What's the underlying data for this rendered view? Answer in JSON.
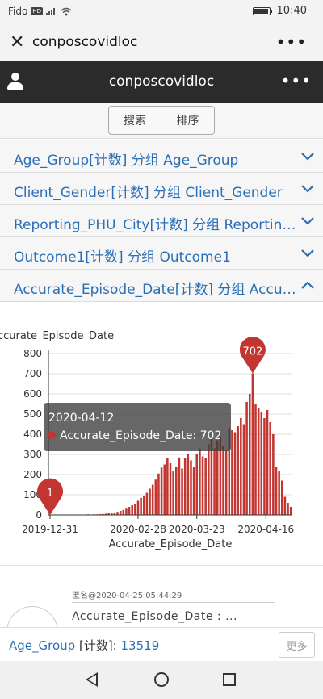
{
  "status_bar": {
    "carrier": "Fido",
    "carrier_badge": "HD",
    "time": "10:40"
  },
  "browser": {
    "title": "conposcovidloc",
    "close_icon": "close-icon",
    "more_icon": "more-icon"
  },
  "app_header": {
    "title": "conposcovidloc",
    "user_icon": "user-icon",
    "more_icon": "more-icon"
  },
  "toolbar": {
    "search_label": "搜索",
    "sort_label": "排序"
  },
  "accordion": [
    {
      "label": "Age_Group[计数] 分组 Age_Group",
      "state": "collapsed"
    },
    {
      "label": "Client_Gender[计数] 分组 Client_Gender",
      "state": "collapsed"
    },
    {
      "label": "Reporting_PHU_City[计数] 分组 Reporting_PHU_City",
      "state": "collapsed"
    },
    {
      "label": "Outcome1[计数] 分组 Outcome1",
      "state": "collapsed"
    },
    {
      "label": "Accurate_Episode_Date[计数] 分组 Accurate_Episode_Date",
      "state": "expanded"
    }
  ],
  "chart_data": {
    "type": "bar",
    "ylabel": "ccurate_Episode_Date",
    "xlabel": "Accurate_Episode_Date",
    "ylim": [
      0,
      800
    ],
    "y_ticks": [
      0,
      100,
      200,
      300,
      400,
      500,
      600,
      700,
      800
    ],
    "x_tick_labels": [
      "2019-12-31",
      "2020-02-28",
      "2020-03-23",
      "2020-04-16"
    ],
    "series": [
      {
        "color": "#c23531"
      }
    ],
    "values": [
      2,
      1,
      1,
      1,
      2,
      1,
      1,
      2,
      1,
      1,
      2,
      1,
      2,
      3,
      2,
      3,
      3,
      4,
      5,
      6,
      8,
      10,
      12,
      15,
      20,
      25,
      35,
      40,
      48,
      55,
      70,
      85,
      95,
      110,
      130,
      150,
      175,
      205,
      235,
      250,
      280,
      260,
      220,
      240,
      285,
      230,
      280,
      300,
      270,
      240,
      300,
      330,
      290,
      280,
      350,
      380,
      330,
      370,
      390,
      340,
      320,
      430,
      420,
      410,
      440,
      480,
      450,
      560,
      600,
      702,
      550,
      530,
      510,
      480,
      520,
      460,
      400,
      240,
      220,
      170,
      90,
      60,
      40
    ],
    "max_marker": {
      "label": "702",
      "value": 702
    },
    "min_marker": {
      "label": "1",
      "value": 1
    },
    "tooltip": {
      "date": "2020-04-12",
      "series_name": "Accurate_Episode_Date",
      "value": "702",
      "text": "Accurate_Episode_Date: 702"
    }
  },
  "message": {
    "meta": "匿名@2020-04-25 05:44:29",
    "text": "Accurate_Episode_Date : ..."
  },
  "footer": {
    "key": "Age_Group",
    "agg": "[计数]:",
    "value": "13519",
    "more_label": "更多"
  },
  "nav": {
    "back_icon": "back-icon",
    "home_icon": "home-icon",
    "recents_icon": "recents-icon"
  }
}
